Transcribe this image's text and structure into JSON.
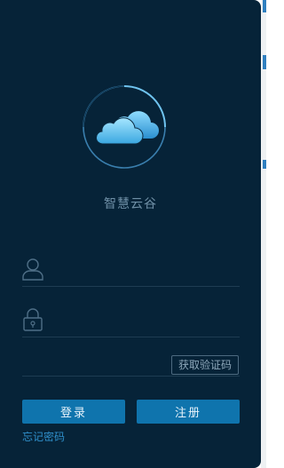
{
  "app": {
    "name": "智慧云谷"
  },
  "login_form": {
    "username_placeholder": "",
    "password_placeholder": "",
    "code_placeholder": "",
    "get_code_label": "获取验证码",
    "login_label": "登录",
    "register_label": "注册",
    "forgot_password_label": "忘记密码"
  },
  "icons": {
    "logo": "cloud-icon",
    "username": "user-icon",
    "password": "lock-icon"
  },
  "colors": {
    "panel_background": "#062338",
    "accent": "#0f74ad",
    "link": "#2f8fca",
    "muted_text": "#6f8fa6"
  }
}
